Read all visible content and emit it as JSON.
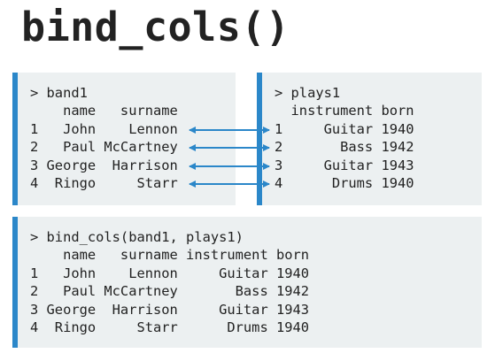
{
  "title": "bind_cols()",
  "band1": {
    "lines": [
      "> band1",
      "    name   surname",
      "1   John    Lennon",
      "2   Paul McCartney",
      "3 George  Harrison",
      "4  Ringo     Starr"
    ]
  },
  "plays1": {
    "lines": [
      "> plays1",
      "  instrument born",
      "1     Guitar 1940",
      "2       Bass 1942",
      "3     Guitar 1943",
      "4      Drums 1940"
    ]
  },
  "result": {
    "lines": [
      "> bind_cols(band1, plays1)",
      "    name   surname instrument born",
      "1   John    Lennon     Guitar 1940",
      "2   Paul McCartney       Bass 1942",
      "3 George  Harrison     Guitar 1943",
      "4  Ringo     Starr      Drums 1940"
    ]
  },
  "colors": {
    "accent": "#2b87c9",
    "box_bg": "#ecf0f1",
    "text": "#222222"
  }
}
